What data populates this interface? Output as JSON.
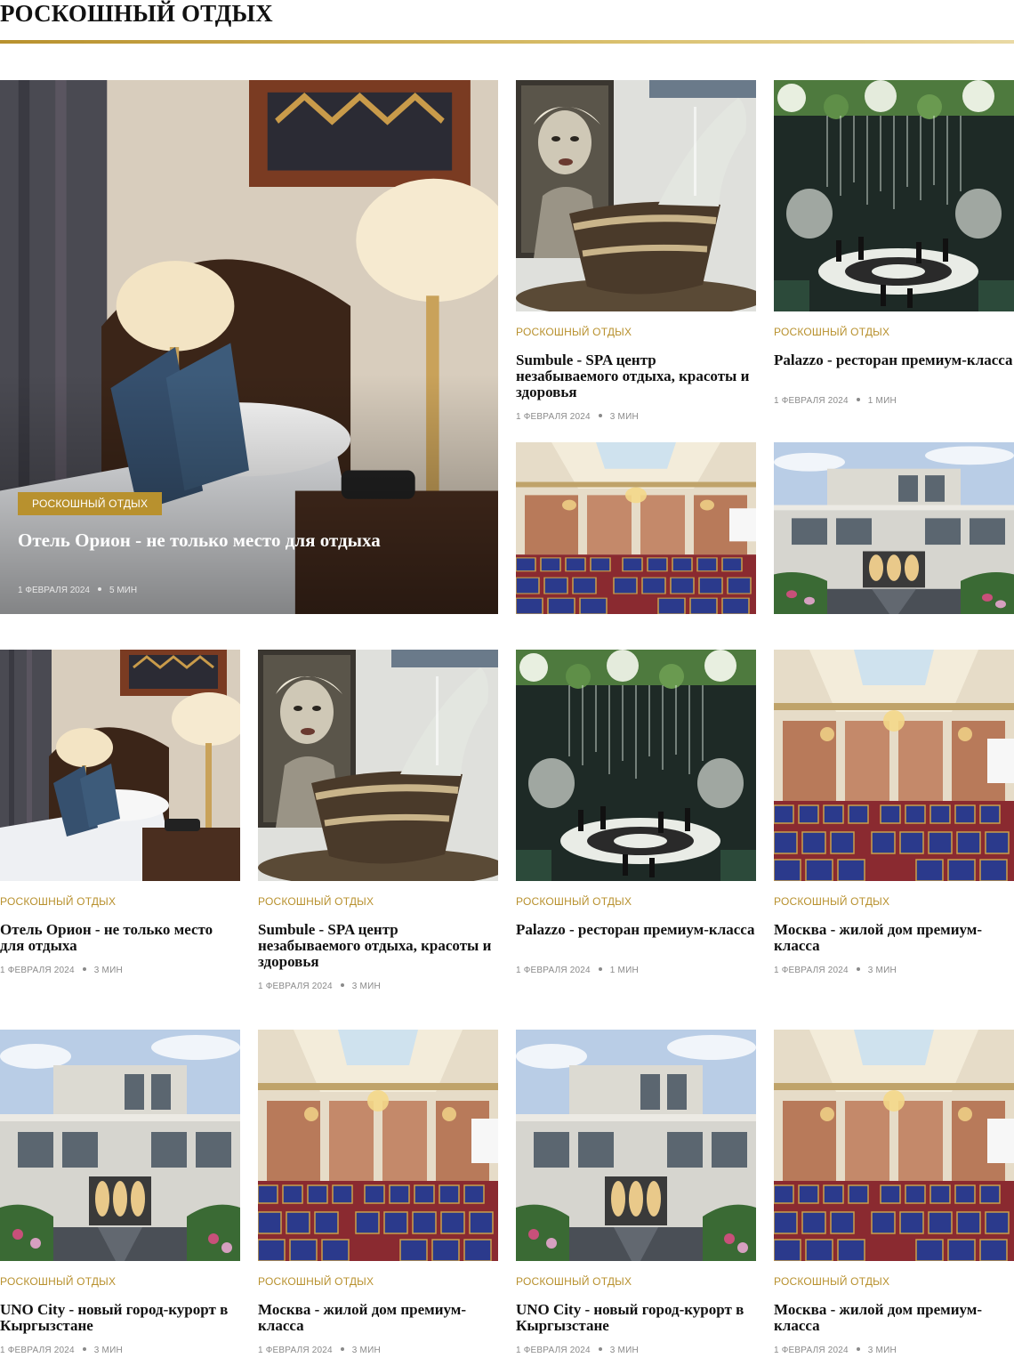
{
  "section": {
    "title": "Роскошный отдых"
  },
  "hero": {
    "category": "Роскошный отдых",
    "title": "Отель Орион - не только место для отдыха",
    "date": "1 февраля 2024",
    "read_time": "5 мин"
  },
  "featured": [
    {
      "category": "Роскошный отдых",
      "title": "Sumbule - SPA центр незабываемого отдыха, красоты и здоровья",
      "date": "1 февраля 2024",
      "read_time": "3 мин"
    },
    {
      "category": "Роскошный отдых",
      "title": "Palazzo - ресторан премиум-класса",
      "date": "1 февраля 2024",
      "read_time": "1 мин"
    }
  ],
  "grid": [
    {
      "category": "Роскошный отдых",
      "title": "Отель Орион - не только место для отдыха",
      "date": "1 февраля 2024",
      "read_time": "3 мин"
    },
    {
      "category": "Роскошный отдых",
      "title": "Sumbule - SPA центр незабываемого отдыха, красоты и здоровья",
      "date": "1 февраля 2024",
      "read_time": "3 мин"
    },
    {
      "category": "Роскошный отдых",
      "title": "Palazzo - ресторан премиум-класса",
      "date": "1 февраля 2024",
      "read_time": "1 мин"
    },
    {
      "category": "Роскошный отдых",
      "title": "Москва - жилой дом премиум-класса",
      "date": "1 февраля 2024",
      "read_time": "3 мин"
    },
    {
      "category": "Роскошный отдых",
      "title": "UNO City - новый город-курорт в Кыргызстане",
      "date": "1 февраля 2024",
      "read_time": "3 мин"
    },
    {
      "category": "Роскошный отдых",
      "title": "Москва - жилой дом премиум-класса",
      "date": "1 февраля 2024",
      "read_time": "3 мин"
    },
    {
      "category": "Роскошный отдых",
      "title": "UNO City - новый город-курорт в Кыргызстане",
      "date": "1 февраля 2024",
      "read_time": "3 мин"
    },
    {
      "category": "Роскошный отдых",
      "title": "Москва - жилой дом премиум-класса",
      "date": "1 февраля 2024",
      "read_time": "3 мин"
    }
  ]
}
